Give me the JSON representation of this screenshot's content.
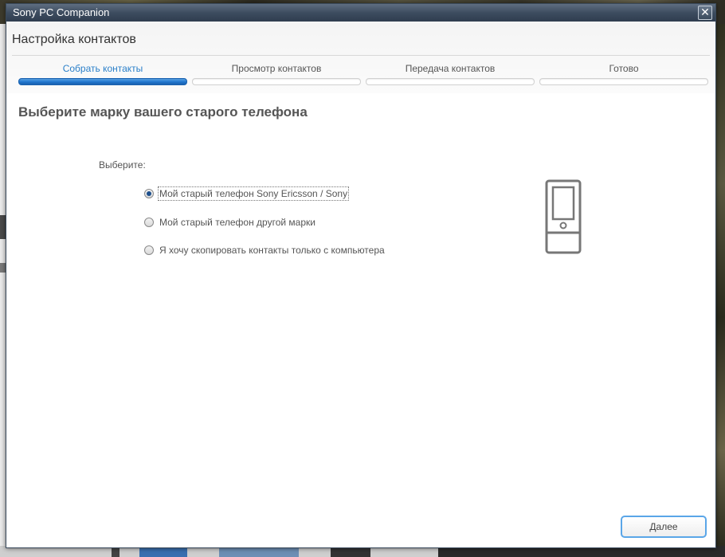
{
  "window": {
    "title": "Sony PC Companion",
    "close_symbol": "✕"
  },
  "header": {
    "title": "Настройка контактов"
  },
  "steps": [
    {
      "label": "Собрать контакты",
      "active": true
    },
    {
      "label": "Просмотр контактов",
      "active": false
    },
    {
      "label": "Передача контактов",
      "active": false
    },
    {
      "label": "Готово",
      "active": false
    }
  ],
  "main": {
    "heading": "Выберите марку вашего старого телефона",
    "choose_label": "Выберите:",
    "options": [
      {
        "label": "Мой старый телефон Sony Ericsson / Sony",
        "checked": true
      },
      {
        "label": "Мой старый телефон другой марки",
        "checked": false
      },
      {
        "label": "Я хочу скопировать контакты только с компьютера",
        "checked": false
      }
    ],
    "illustration_icon": "phone-icon"
  },
  "footer": {
    "next_label": "Далее"
  },
  "colors": {
    "accent": "#2a7fc9",
    "titlebar": "#3d4c5f",
    "button_border": "#5aa6e8"
  }
}
